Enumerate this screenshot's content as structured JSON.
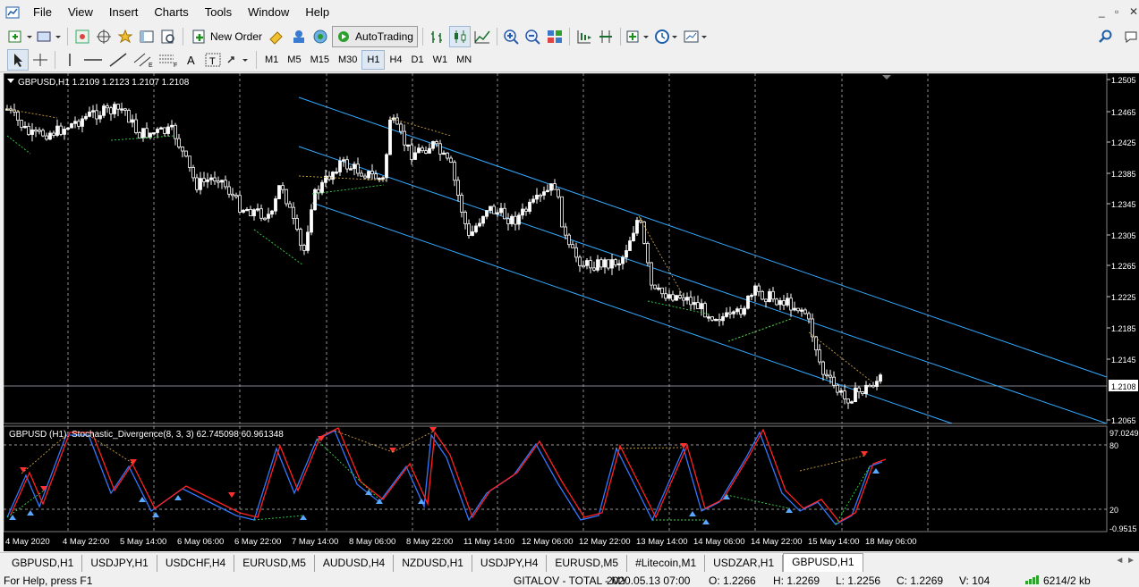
{
  "menu": [
    "File",
    "View",
    "Insert",
    "Charts",
    "Tools",
    "Window",
    "Help"
  ],
  "toolbar": {
    "new_order": "New Order",
    "autotrading": "AutoTrading"
  },
  "timeframes": [
    "M1",
    "M5",
    "M15",
    "M30",
    "H1",
    "H4",
    "D1",
    "W1",
    "MN"
  ],
  "active_timeframe": "H1",
  "chart": {
    "header": "GBPUSD,H1  1.2109 1.2123 1.2107 1.2108",
    "price_labels": [
      "1.2505",
      "1.2465",
      "1.2425",
      "1.2385",
      "1.2345",
      "1.2305",
      "1.2265",
      "1.2225",
      "1.2185",
      "1.2145",
      "1.2108",
      "1.2065"
    ],
    "current_price": "1.2108",
    "indicator_header": "GBPUSD (H1): Stochastic_Divergence(8, 3, 3) 62.745098 60.961348",
    "indicator_levels": [
      "97.0249",
      "80",
      "20",
      "-0.9515"
    ],
    "time_labels": [
      "4 May 2020",
      "4 May 22:00",
      "5 May 14:00",
      "6 May 06:00",
      "6 May 22:00",
      "7 May 14:00",
      "8 May 06:00",
      "8 May 22:00",
      "11 May 14:00",
      "12 May 06:00",
      "12 May 22:00",
      "13 May 14:00",
      "14 May 06:00",
      "14 May 22:00",
      "15 May 14:00",
      "18 May 06:00"
    ],
    "colors": {
      "background": "#000000",
      "bull": "#ffffff",
      "channel": "#33aaff",
      "stoch_main": "#3377ff",
      "stoch_signal": "#ff2222",
      "grid": "#c8c8c8"
    }
  },
  "tabs": [
    "GBPUSD,H1",
    "USDJPY,H1",
    "USDCHF,H4",
    "EURUSD,M5",
    "AUDUSD,H4",
    "NZDUSD,H1",
    "USDJPY,H4",
    "EURUSD,M5",
    "#Litecoin,M1",
    "USDZAR,H1",
    "GBPUSD,H1"
  ],
  "active_tab": 10,
  "status": {
    "help": "For Help, press F1",
    "profile": "GITALOV - TOTAL - MY",
    "datetime": "2020.05.13 07:00",
    "open": "O: 1.2266",
    "high": "H: 1.2269",
    "low": "L: 1.2256",
    "close": "C: 1.2269",
    "volume": "V: 104",
    "traffic": "6214/2 kb"
  }
}
